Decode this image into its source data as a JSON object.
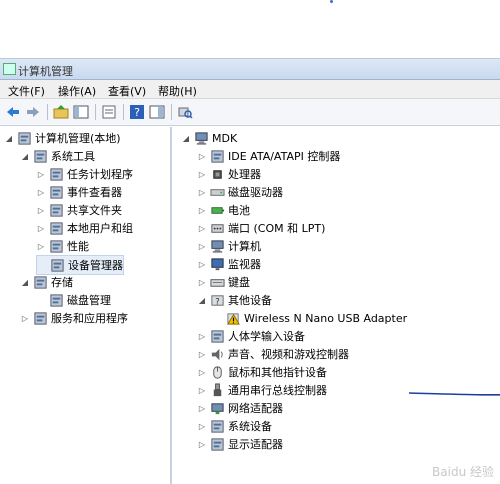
{
  "window": {
    "title": "计算机管理"
  },
  "menu": [
    "文件(F)",
    "操作(A)",
    "查看(V)",
    "帮助(H)"
  ],
  "toolbar_icons": [
    "back-arrow-icon",
    "forward-arrow-icon",
    "up-folder-icon",
    "show-hide-tree-icon",
    "properties-icon",
    "help-icon",
    "action-pane-icon",
    "scan-hardware-icon"
  ],
  "left_tree": [
    {
      "label": "计算机管理(本地)",
      "icon": "computer-management-icon",
      "level": 0,
      "expander": "◢"
    },
    {
      "label": "系统工具",
      "icon": "system-tools-icon",
      "level": 1,
      "expander": "◢"
    },
    {
      "label": "任务计划程序",
      "icon": "task-scheduler-icon",
      "level": 2,
      "expander": "▷"
    },
    {
      "label": "事件查看器",
      "icon": "event-viewer-icon",
      "level": 2,
      "expander": "▷"
    },
    {
      "label": "共享文件夹",
      "icon": "shared-folder-icon",
      "level": 2,
      "expander": "▷"
    },
    {
      "label": "本地用户和组",
      "icon": "users-icon",
      "level": 2,
      "expander": "▷"
    },
    {
      "label": "性能",
      "icon": "performance-icon",
      "level": 2,
      "expander": "▷"
    },
    {
      "label": "设备管理器",
      "icon": "device-manager-icon",
      "level": 2,
      "expander": "",
      "selected": true
    },
    {
      "label": "存储",
      "icon": "storage-icon",
      "level": 1,
      "expander": "◢"
    },
    {
      "label": "磁盘管理",
      "icon": "disk-management-icon",
      "level": 2,
      "expander": ""
    },
    {
      "label": "服务和应用程序",
      "icon": "services-icon",
      "level": 1,
      "expander": "▷"
    }
  ],
  "right_tree": [
    {
      "label": "MDK",
      "icon": "computer-icon",
      "level": 0,
      "expander": "◢"
    },
    {
      "label": "IDE ATA/ATAPI 控制器",
      "icon": "ide-controller-icon",
      "level": 1,
      "expander": "▷"
    },
    {
      "label": "处理器",
      "icon": "processor-icon",
      "level": 1,
      "expander": "▷"
    },
    {
      "label": "磁盘驱动器",
      "icon": "disk-drive-icon",
      "level": 1,
      "expander": "▷"
    },
    {
      "label": "电池",
      "icon": "battery-icon",
      "level": 1,
      "expander": "▷"
    },
    {
      "label": "端口 (COM 和 LPT)",
      "icon": "port-icon",
      "level": 1,
      "expander": "▷"
    },
    {
      "label": "计算机",
      "icon": "computer-icon",
      "level": 1,
      "expander": "▷"
    },
    {
      "label": "监视器",
      "icon": "monitor-icon",
      "level": 1,
      "expander": "▷"
    },
    {
      "label": "键盘",
      "icon": "keyboard-icon",
      "level": 1,
      "expander": "▷"
    },
    {
      "label": "其他设备",
      "icon": "other-devices-icon",
      "level": 1,
      "expander": "◢"
    },
    {
      "label": "Wireless N Nano USB Adapter",
      "icon": "warning-device-icon",
      "level": 2,
      "expander": ""
    },
    {
      "label": "人体学输入设备",
      "icon": "hid-icon",
      "level": 1,
      "expander": "▷"
    },
    {
      "label": "声音、视频和游戏控制器",
      "icon": "sound-icon",
      "level": 1,
      "expander": "▷"
    },
    {
      "label": "鼠标和其他指针设备",
      "icon": "mouse-icon",
      "level": 1,
      "expander": "▷"
    },
    {
      "label": "通用串行总线控制器",
      "icon": "usb-icon",
      "level": 1,
      "expander": "▷"
    },
    {
      "label": "网络适配器",
      "icon": "network-adapter-icon",
      "level": 1,
      "expander": "▷"
    },
    {
      "label": "系统设备",
      "icon": "system-devices-icon",
      "level": 1,
      "expander": "▷"
    },
    {
      "label": "显示适配器",
      "icon": "display-adapter-icon",
      "level": 1,
      "expander": "▷"
    }
  ],
  "watermark": "Baidu 经验",
  "colors": {
    "titlebar": "#c9d9ee",
    "toolbar": "#f4f6f9",
    "accent": "#2b5797",
    "warning": "#f2c200",
    "pen": "#1b3f9c"
  }
}
